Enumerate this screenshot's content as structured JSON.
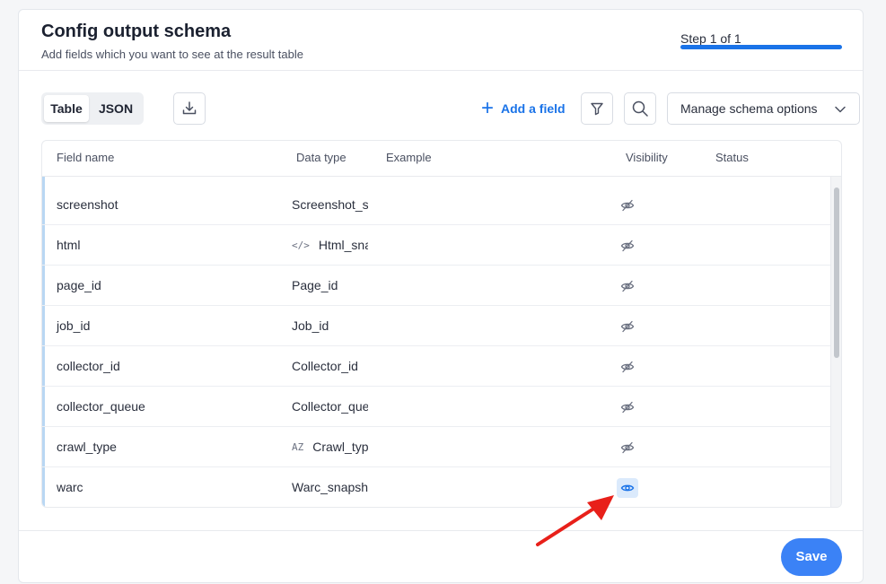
{
  "header": {
    "title": "Config output schema",
    "subtitle": "Add fields which you want to see at the result table",
    "step": "Step 1 of 1"
  },
  "toolbar": {
    "view_tabs": [
      {
        "label": "Table",
        "active": true
      },
      {
        "label": "JSON",
        "active": false
      }
    ],
    "download_icon": "download-icon",
    "add_field_label": "Add a field",
    "filter_icon": "filter-icon",
    "search_icon": "search-icon",
    "schema_options_label": "Manage schema options"
  },
  "table": {
    "columns": {
      "field_name": "Field name",
      "data_type": "Data type",
      "example": "Example",
      "visibility": "Visibility",
      "status": "Status"
    },
    "rows": [
      {
        "field": "screenshot",
        "type": "Screenshot_snapshot",
        "type_icon": "",
        "visible": false
      },
      {
        "field": "html",
        "type": "Html_snapshot",
        "type_icon": "</>",
        "visible": false
      },
      {
        "field": "page_id",
        "type": "Page_id",
        "type_icon": "",
        "visible": false
      },
      {
        "field": "job_id",
        "type": "Job_id",
        "type_icon": "",
        "visible": false
      },
      {
        "field": "collector_id",
        "type": "Collector_id",
        "type_icon": "",
        "visible": false
      },
      {
        "field": "collector_queue",
        "type": "Collector_queue",
        "type_icon": "",
        "visible": false
      },
      {
        "field": "crawl_type",
        "type": "Crawl_type",
        "type_icon": "AZ",
        "visible": false
      },
      {
        "field": "warc",
        "type": "Warc_snapshot",
        "type_icon": "",
        "visible": true
      }
    ]
  },
  "footer": {
    "save_label": "Save"
  },
  "colors": {
    "accent": "#1a73e8",
    "save": "#3b82f6",
    "annotation_arrow": "#e8201a"
  }
}
